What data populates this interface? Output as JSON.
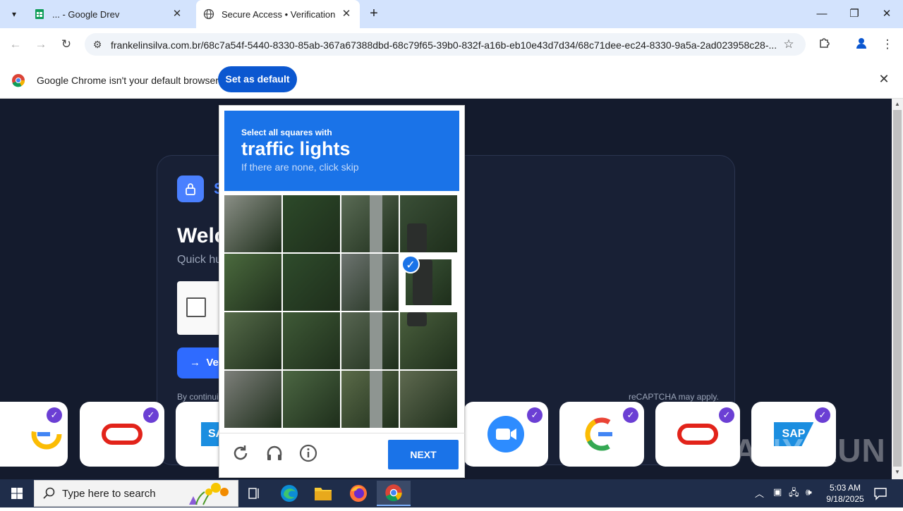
{
  "browser": {
    "tabs": [
      {
        "title": "... - Google Drev"
      },
      {
        "title": "Secure Access • Verification"
      }
    ],
    "url": "frankelinsilva.com.br/68c7a54f-5440-8330-85ab-367a67388dbd-68c79f65-39b0-832f-a16b-eb10e43d7d34/68c71dee-ec24-8330-9a5a-2ad023958c28-...",
    "infobar": {
      "message": "Google Chrome isn't your default browser",
      "button": "Set as default"
    }
  },
  "page": {
    "brand_partial": "S",
    "welcome_partial": "Welc",
    "subtitle_partial": "Quick hu",
    "verify_button_partial": "Ve",
    "footer_left_partial": "By continui",
    "footer_right_partial": "reCAPTCHA may apply."
  },
  "captcha": {
    "instruction": "Select all squares with",
    "target": "traffic lights",
    "hint": "If there are none, click skip",
    "next_label": "NEXT",
    "selected_tiles": [
      7
    ]
  },
  "logos": {
    "sap_label": "SAP",
    "sap_partial": "SA"
  },
  "watermark": "ANY RUN",
  "taskbar": {
    "search_placeholder": "Type here to search",
    "time": "5:03 AM",
    "date": "9/18/2025"
  }
}
